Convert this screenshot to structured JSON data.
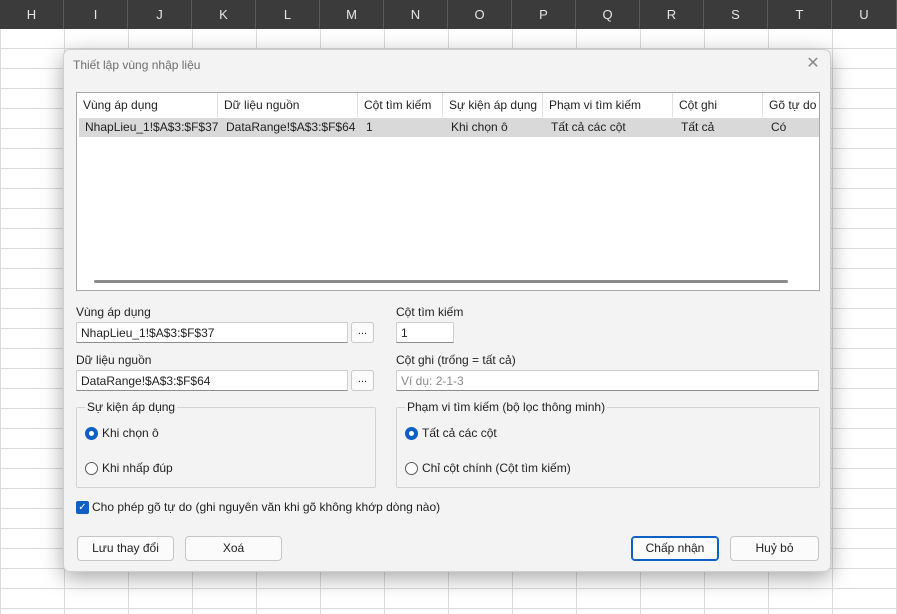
{
  "sheet": {
    "columns": [
      "H",
      "I",
      "J",
      "K",
      "L",
      "M",
      "N",
      "O",
      "P",
      "Q",
      "R",
      "S",
      "T",
      "U"
    ]
  },
  "dialog": {
    "title": "Thiết lập vùng nhập liệu",
    "close_icon": "close-icon"
  },
  "list": {
    "columns": [
      "Vùng áp dụng",
      "Dữ liệu nguồn",
      "Cột tìm kiếm",
      "Sự kiện áp dụng",
      "Phạm vi tìm kiếm",
      "Cột ghi",
      "Gõ tự do"
    ],
    "rows": [
      [
        "NhapLieu_1!$A$3:$F$37",
        "DataRange!$A$3:$F$64",
        "1",
        "Khi chọn ô",
        "Tất cả các cột",
        "Tất cả",
        "Có"
      ]
    ]
  },
  "form": {
    "apply_range_label": "Vùng áp dụng",
    "apply_range_value": "NhapLieu_1!$A$3:$F$37",
    "source_label": "Dữ liệu nguồn",
    "source_value": "DataRange!$A$3:$F$64",
    "browse_label": "...",
    "search_col_label": "Cột tìm kiếm",
    "search_col_value": "1",
    "write_cols_label": "Cột ghi (trống = tất cả)",
    "write_cols_placeholder": "Ví dụ: 2-1-3"
  },
  "event_group": {
    "title": "Sự kiện áp dụng",
    "options": [
      "Khi chọn ô",
      "Khi nhấp đúp"
    ],
    "selected": 0
  },
  "scope_group": {
    "title": "Phạm vi tìm kiếm (bộ lọc thông minh)",
    "options": [
      "Tất cả các cột",
      "Chỉ cột chính (Cột tìm kiếm)"
    ],
    "selected": 0
  },
  "free_typing": {
    "label": "Cho phép gõ tự do (ghi nguyên văn khi gõ không khớp dòng nào)",
    "checked": true
  },
  "buttons": {
    "save": "Lưu thay đổi",
    "delete": "Xoá",
    "accept": "Chấp nhận",
    "cancel": "Huỷ bỏ"
  },
  "colors": {
    "accent": "#0f5fc4",
    "sheet_header": "#3b3b3b",
    "row_selected": "#d9d9d9"
  }
}
